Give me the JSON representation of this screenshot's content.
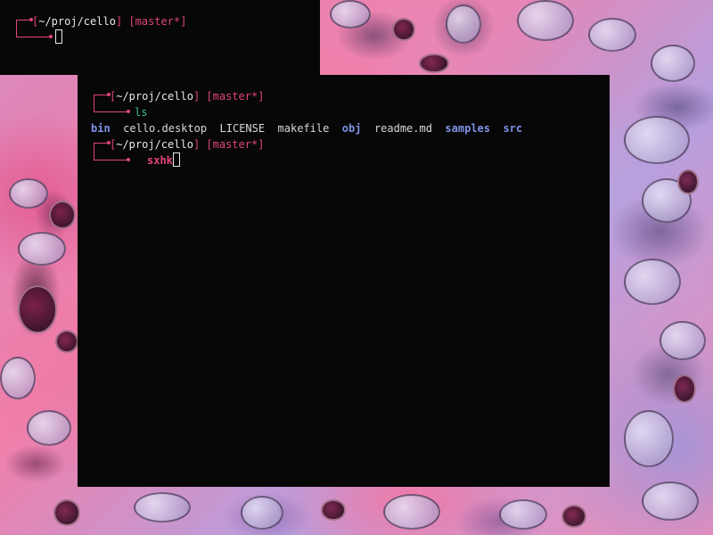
{
  "colors": {
    "background": "#070707",
    "accent_pink": "#e0457a",
    "command_green": "#3dbd9a",
    "directory_blue": "#7e93e6",
    "text": "#d8d8d8"
  },
  "terminal_back": {
    "prompt": {
      "open_bracket": "[",
      "path": "~/proj/cello",
      "close_bracket": "]",
      "branch": "[master*]"
    }
  },
  "terminal_front": {
    "prompt1": {
      "open_bracket": "[",
      "path": "~/proj/cello",
      "close_bracket": "]",
      "branch": "[master*]",
      "command": "ls"
    },
    "ls_output": [
      {
        "name": "bin",
        "type": "dir"
      },
      {
        "name": "cello.desktop",
        "type": "file"
      },
      {
        "name": "LICENSE",
        "type": "file"
      },
      {
        "name": "makefile",
        "type": "file"
      },
      {
        "name": "obj",
        "type": "dir"
      },
      {
        "name": "readme.md",
        "type": "file"
      },
      {
        "name": "samples",
        "type": "dir"
      },
      {
        "name": "src",
        "type": "dir"
      }
    ],
    "prompt2": {
      "open_bracket": "[",
      "path": "~/proj/cello",
      "close_bracket": "]",
      "branch": "[master*]",
      "command": "sxhk"
    }
  }
}
